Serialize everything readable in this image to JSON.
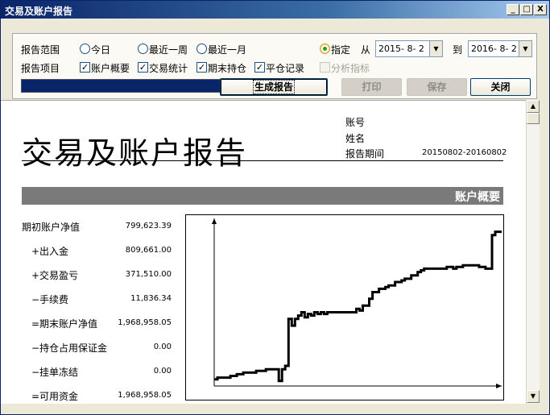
{
  "window": {
    "title": "交易及账户报告",
    "controls": {
      "minimize": "_",
      "maximize": "□",
      "close": "X"
    }
  },
  "options": {
    "range_label": "报告范围",
    "range_options": [
      "今日",
      "最近一周",
      "最近一月",
      "指定"
    ],
    "range_selected": "指定",
    "from_label": "从",
    "from_date": "2015- 8- 2",
    "to_label": "到",
    "to_date": "2016- 8- 2",
    "items_label": "报告项目",
    "items": [
      {
        "label": "账户概要",
        "checked": true,
        "enabled": true
      },
      {
        "label": "交易统计",
        "checked": true,
        "enabled": true
      },
      {
        "label": "期末持仓",
        "checked": true,
        "enabled": true
      },
      {
        "label": "平仓记录",
        "checked": true,
        "enabled": true
      },
      {
        "label": "分析指标",
        "checked": false,
        "enabled": false
      }
    ],
    "progress": 1.0,
    "generate_label": "生成报告",
    "print_label": "打印",
    "save_label": "保存",
    "close_label": "关闭"
  },
  "report": {
    "title": "交易及账户报告",
    "account_label": "账号",
    "name_label": "姓名",
    "period_label": "报告期间",
    "period_value": "20150802-20160802",
    "section_title": "账户概要",
    "rows": [
      {
        "label": "期初账户净值",
        "value": "799,623.39"
      },
      {
        "label": "+出入金",
        "value": "809,661.00"
      },
      {
        "label": "+交易盈亏",
        "value": "371,510.00"
      },
      {
        "label": "−手续费",
        "value": "11,836.34"
      },
      {
        "label": "=期末账户净值",
        "value": "1,968,958.05"
      },
      {
        "label": "−持仓占用保证金",
        "value": "0.00"
      },
      {
        "label": "−挂单冻结",
        "value": "0.00"
      },
      {
        "label": "=可用资金",
        "value": "1,968,958.05"
      }
    ]
  },
  "chart_data": {
    "type": "line",
    "title": "",
    "xlabel": "",
    "ylabel": "",
    "series": [
      {
        "values": [
          0.04,
          0.05,
          0.05,
          0.05,
          0.05,
          0.06,
          0.06,
          0.07,
          0.07,
          0.08,
          0.08,
          0.08,
          0.08,
          0.09,
          0.09,
          0.09,
          0.1,
          0.1,
          0.1,
          0.1,
          0.03,
          0.1,
          0.12,
          0.4,
          0.36,
          0.4,
          0.42,
          0.44,
          0.41,
          0.43,
          0.42,
          0.44,
          0.43,
          0.44,
          0.43,
          0.44,
          0.44,
          0.44,
          0.44,
          0.44,
          0.44,
          0.44,
          0.44,
          0.44,
          0.46,
          0.45,
          0.48,
          0.48,
          0.52,
          0.56,
          0.56,
          0.58,
          0.58,
          0.59,
          0.6,
          0.6,
          0.62,
          0.62,
          0.63,
          0.64,
          0.64,
          0.66,
          0.66,
          0.68,
          0.69,
          0.7,
          0.7,
          0.7,
          0.7,
          0.7,
          0.7,
          0.7,
          0.71,
          0.71,
          0.7,
          0.71,
          0.71,
          0.72,
          0.72,
          0.72,
          0.72,
          0.72,
          0.71,
          0.71,
          0.7,
          0.7,
          0.9,
          0.92,
          0.92,
          0.92
        ]
      }
    ],
    "ylim": [
      0,
      1
    ],
    "grid": false
  }
}
